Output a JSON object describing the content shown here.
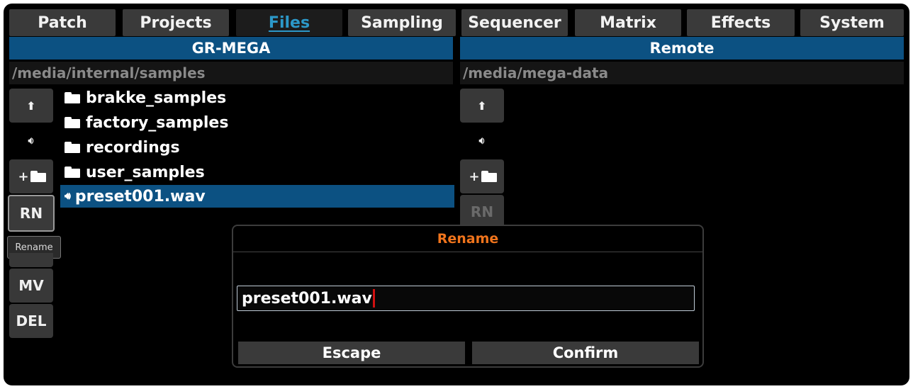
{
  "tabs": [
    {
      "label": "Patch",
      "active": false
    },
    {
      "label": "Projects",
      "active": false
    },
    {
      "label": "Files",
      "active": true
    },
    {
      "label": "Sampling",
      "active": false
    },
    {
      "label": "Sequencer",
      "active": false
    },
    {
      "label": "Matrix",
      "active": false
    },
    {
      "label": "Effects",
      "active": false
    },
    {
      "label": "System",
      "active": false
    }
  ],
  "left_panel": {
    "title": "GR-MEGA",
    "path": "/media/internal/samples",
    "buttons": {
      "up_icon": "up-arrow-icon",
      "speaker_icon": "speaker-icon",
      "new_folder_icon": "new-folder-icon",
      "rename": "RN",
      "move": "MV",
      "delete": "DEL"
    },
    "tooltip": "Rename",
    "files": [
      {
        "name": "brakke_samples",
        "type": "folder"
      },
      {
        "name": "factory_samples",
        "type": "folder"
      },
      {
        "name": "recordings",
        "type": "folder"
      },
      {
        "name": "user_samples",
        "type": "folder"
      },
      {
        "name": "preset001.wav",
        "type": "audio",
        "selected": true
      }
    ]
  },
  "right_panel": {
    "title": "Remote",
    "path": "/media/mega-data",
    "buttons": {
      "up_icon": "up-arrow-icon",
      "speaker_icon": "speaker-icon",
      "new_folder_icon": "new-folder-icon",
      "rename": "RN"
    }
  },
  "dialog": {
    "title": "Rename",
    "input_value": "preset001.wav",
    "escape_label": "Escape",
    "confirm_label": "Confirm"
  },
  "colors": {
    "accent": "#0c5182",
    "active_tab_text": "#2c98c8",
    "dialog_title": "#f0741c",
    "caret": "#d01010"
  }
}
